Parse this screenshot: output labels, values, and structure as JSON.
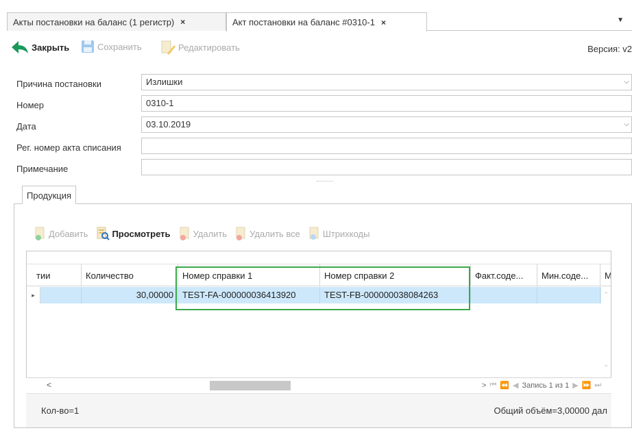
{
  "tabs": [
    {
      "label": "Акты постановки на баланс (1 регистр)",
      "close": "×"
    },
    {
      "label": "Акт постановки на баланс #0310-1",
      "close": "×"
    }
  ],
  "tab_menu": "▼",
  "toolbar": {
    "close_label": "Закрыть",
    "save_label": "Сохранить",
    "edit_label": "Редактировать",
    "version": "Версия: v2"
  },
  "form": {
    "reason_label": "Причина постановки",
    "reason_value": "Излишки",
    "number_label": "Номер",
    "number_value": "0310-1",
    "date_label": "Дата",
    "date_value": "03.10.2019",
    "reg_label": "Рег. номер акта списания",
    "reg_value": "",
    "note_label": "Примечание",
    "note_value": ""
  },
  "products_tab": "Продукция",
  "subtoolbar": {
    "add": "Добавить",
    "view": "Просмотреть",
    "delete": "Удалить",
    "delete_all": "Удалить все",
    "barcodes": "Штрихкоды"
  },
  "grid": {
    "columns": [
      "тии",
      "Количество",
      "Номер справки 1",
      "Номер справки 2",
      "Факт.соде...",
      "Мин.соде...",
      "М"
    ],
    "rows": [
      {
        "col0": "",
        "quantity": "30,00000",
        "ref1": "TEST-FA-000000036413920",
        "ref2": "TEST-FB-000000038084263",
        "fact": "",
        "min": "",
        "m": ""
      }
    ],
    "pager_text": "Запись 1 из 1"
  },
  "footer": {
    "count": "Кол-во=1",
    "volume": "Общий объём=3,00000 дал"
  },
  "colors": {
    "highlight": "#3aa84a",
    "selected_row": "#cde8fb",
    "arrow_green": "#1a9a5a"
  },
  "icons": [
    "arrow-back-icon",
    "save-disk-icon",
    "edit-pencil-icon",
    "doc-add-icon",
    "doc-view-icon",
    "doc-delete-icon",
    "barcode-doc-icon"
  ]
}
